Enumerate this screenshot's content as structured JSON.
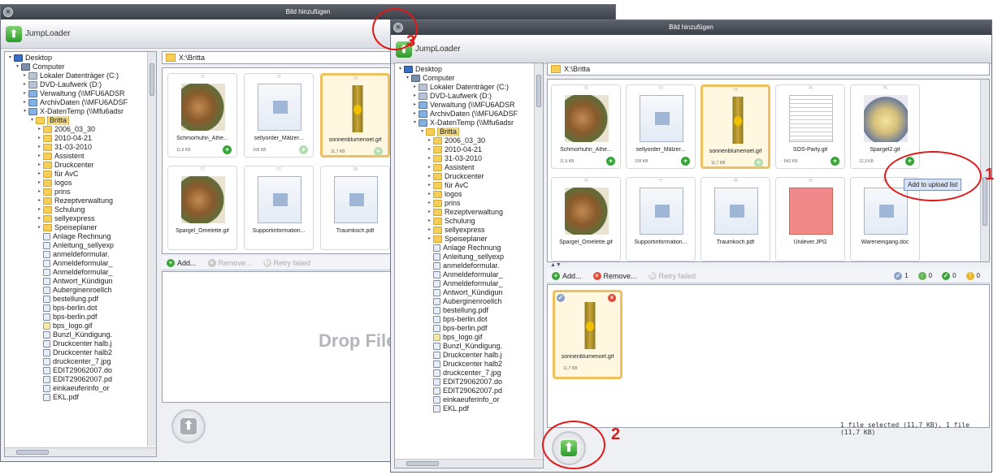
{
  "app": {
    "window_title": "Bild hinzufügen",
    "app_name": "JumpLoader",
    "close_glyph": "×",
    "up_glyph": "⬆"
  },
  "path": {
    "value": "X:\\Britta"
  },
  "tree": [
    {
      "label": "Desktop",
      "icon": "desktop",
      "indent": 0,
      "exp": "▾"
    },
    {
      "label": "Computer",
      "icon": "computer",
      "indent": 1,
      "exp": "▾"
    },
    {
      "label": "Lokaler Datenträger (C:)",
      "icon": "drive",
      "indent": 2,
      "exp": "▸"
    },
    {
      "label": "DVD-Laufwerk (D:)",
      "icon": "drive",
      "indent": 2,
      "exp": "▸"
    },
    {
      "label": "Verwaltung (\\\\MFU6ADSR",
      "icon": "net",
      "indent": 2,
      "exp": "▸"
    },
    {
      "label": "ArchivDaten (\\\\MFU6ADSF",
      "icon": "net",
      "indent": 2,
      "exp": "▸"
    },
    {
      "label": "X-DatenTemp (\\\\Mfu6adsr",
      "icon": "net",
      "indent": 2,
      "exp": "▾"
    },
    {
      "label": "Britta",
      "icon": "folder",
      "indent": 3,
      "exp": "▾",
      "selected": true
    },
    {
      "label": "2006_03_30",
      "icon": "folder",
      "indent": 4,
      "exp": "▸"
    },
    {
      "label": "2010-04-21",
      "icon": "folder",
      "indent": 4,
      "exp": "▸"
    },
    {
      "label": "31-03-2010",
      "icon": "folder",
      "indent": 4,
      "exp": "▸"
    },
    {
      "label": "Assistent",
      "icon": "folder",
      "indent": 4,
      "exp": "▸"
    },
    {
      "label": "Druckcenter",
      "icon": "folder",
      "indent": 4,
      "exp": "▸"
    },
    {
      "label": "für AvC",
      "icon": "folder",
      "indent": 4,
      "exp": "▸"
    },
    {
      "label": "logos",
      "icon": "folder",
      "indent": 4,
      "exp": "▸"
    },
    {
      "label": "prins",
      "icon": "folder",
      "indent": 4,
      "exp": "▸"
    },
    {
      "label": "Rezeptverwaltung",
      "icon": "folder",
      "indent": 4,
      "exp": "▸"
    },
    {
      "label": "Schulung",
      "icon": "folder",
      "indent": 4,
      "exp": "▸"
    },
    {
      "label": "sellyexpress",
      "icon": "folder",
      "indent": 4,
      "exp": "▸"
    },
    {
      "label": "Speiseplaner",
      "icon": "folder",
      "indent": 4,
      "exp": "▸"
    },
    {
      "label": "Anlage Rechnung",
      "icon": "file",
      "indent": 4,
      "exp": ""
    },
    {
      "label": "Anleitung_sellyexp",
      "icon": "file",
      "indent": 4,
      "exp": ""
    },
    {
      "label": "anmeldeformular.",
      "icon": "file",
      "indent": 4,
      "exp": ""
    },
    {
      "label": "Anmeldeformular_",
      "icon": "file",
      "indent": 4,
      "exp": ""
    },
    {
      "label": "Anmeldeformular_",
      "icon": "file",
      "indent": 4,
      "exp": ""
    },
    {
      "label": "Antwort_Kündigun",
      "icon": "file",
      "indent": 4,
      "exp": ""
    },
    {
      "label": "Auberginenroellch",
      "icon": "file",
      "indent": 4,
      "exp": ""
    },
    {
      "label": "bestellung.pdf",
      "icon": "file",
      "indent": 4,
      "exp": ""
    },
    {
      "label": "bps-berlin.dot",
      "icon": "file",
      "indent": 4,
      "exp": ""
    },
    {
      "label": "bps-berlin.pdf",
      "icon": "file",
      "indent": 4,
      "exp": ""
    },
    {
      "label": "bps_logo.gif",
      "icon": "gif",
      "indent": 4,
      "exp": ""
    },
    {
      "label": "Bunzl_Kündigung.",
      "icon": "file",
      "indent": 4,
      "exp": ""
    },
    {
      "label": "Druckcenter halb.j",
      "icon": "file",
      "indent": 4,
      "exp": ""
    },
    {
      "label": "Druckcenter halb2",
      "icon": "file",
      "indent": 4,
      "exp": ""
    },
    {
      "label": "druckcenter_7.jpg",
      "icon": "file",
      "indent": 4,
      "exp": ""
    },
    {
      "label": "EDIT29062007.do",
      "icon": "file",
      "indent": 4,
      "exp": ""
    },
    {
      "label": "EDIT29062007.pd",
      "icon": "file",
      "indent": 4,
      "exp": ""
    },
    {
      "label": "einkaeuferinfo_or",
      "icon": "file",
      "indent": 4,
      "exp": ""
    },
    {
      "label": "EKL.pdf",
      "icon": "file",
      "indent": 4,
      "exp": ""
    }
  ],
  "left_files": [
    {
      "num": "71",
      "name": "Schmorhuhn_Athe...",
      "size": "11,6 KB",
      "img": "food",
      "selected": false,
      "add": true
    },
    {
      "num": "72",
      "name": "sellyorder_Mälzer...",
      "size": "109 KB",
      "img": "doc",
      "selected": false,
      "add": false
    },
    {
      "num": "73",
      "name": "sonnenblumenoel.gif",
      "size": "11,7 KB",
      "img": "bottle",
      "selected": true,
      "add": false
    },
    {
      "num": "77",
      "name": "Spargel_Omelette.gif",
      "size": "",
      "img": "food",
      "selected": false,
      "add": false
    },
    {
      "num": "77",
      "name": "Supportinformation...",
      "size": "",
      "img": "doc",
      "selected": false,
      "add": false
    },
    {
      "num": "78",
      "name": "Traumkoch.pdf",
      "size": "",
      "img": "doc",
      "selected": false,
      "add": false
    }
  ],
  "right_files": [
    {
      "num": "71",
      "name": "Schmorhuhn_Athe...",
      "size": "11,6 KB",
      "img": "food",
      "selected": false,
      "add": true
    },
    {
      "num": "72",
      "name": "sellyorder_Mälzer...",
      "size": "109 KB",
      "img": "doc",
      "selected": false,
      "add": true
    },
    {
      "num": "73",
      "name": "sonnenblumenoel.gif",
      "size": "11,7 KB",
      "img": "bottle",
      "selected": true,
      "add": false
    },
    {
      "num": "74",
      "name": "SOS-Party.gif",
      "size": "842 KB",
      "img": "scan",
      "selected": false,
      "add": true
    },
    {
      "num": "75",
      "name": "Spargel2.gif",
      "size": "12,3 KB",
      "img": "dish",
      "selected": false,
      "add": true
    },
    {
      "num": "76",
      "name": "Spargel_Omelette.gif",
      "size": "",
      "img": "food",
      "selected": false,
      "add": false
    },
    {
      "num": "77",
      "name": "Supportinformation...",
      "size": "",
      "img": "doc",
      "selected": false,
      "add": false
    },
    {
      "num": "78",
      "name": "Traumkoch.pdf",
      "size": "",
      "img": "doc",
      "selected": false,
      "add": false
    },
    {
      "num": "79",
      "name": "Unilever.JPG",
      "size": "",
      "img": "pink",
      "selected": false,
      "add": false
    },
    {
      "num": "80",
      "name": "Wareneingang.doc",
      "size": "",
      "img": "doc",
      "selected": false,
      "add": false
    }
  ],
  "upload_toolbar": {
    "add": "Add...",
    "remove": "Remove...",
    "retry": "Retry failed",
    "stats": [
      "1",
      "0",
      "0",
      "0"
    ]
  },
  "queue": {
    "name": "sonnenblumenoel.gif",
    "size": "11,7 KB"
  },
  "drop_text": "Drop File",
  "tooltip": "Add to upload list",
  "status_text": "1 file selected (11,7 KB), 1 file (11,7 KB)",
  "annotations": {
    "one": "1",
    "two": "2",
    "three": "3"
  },
  "colors": {
    "annotation": "#e01818",
    "accent_green": "#3aa33a",
    "selection_gold": "#f0c060"
  }
}
